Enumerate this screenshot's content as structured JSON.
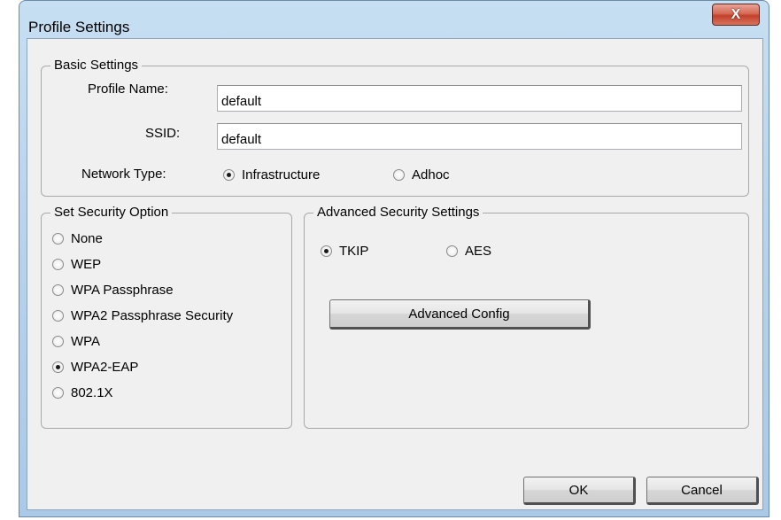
{
  "window": {
    "title": "Profile Settings",
    "close_glyph": "X"
  },
  "basic": {
    "legend": "Basic Settings",
    "profile_name_label": "Profile Name:",
    "profile_name_value": "default",
    "ssid_label": "SSID:",
    "ssid_value": "default",
    "network_type_label": "Network Type:",
    "network_options": [
      {
        "label": "Infrastructure",
        "selected": true
      },
      {
        "label": "Adhoc",
        "selected": false
      }
    ]
  },
  "security": {
    "legend": "Set Security Option",
    "options": [
      {
        "label": "None",
        "selected": false
      },
      {
        "label": "WEP",
        "selected": false
      },
      {
        "label": "WPA Passphrase",
        "selected": false
      },
      {
        "label": "WPA2 Passphrase Security",
        "selected": false
      },
      {
        "label": "WPA",
        "selected": false
      },
      {
        "label": "WPA2-EAP",
        "selected": true
      },
      {
        "label": "802.1X",
        "selected": false
      }
    ]
  },
  "advanced": {
    "legend": "Advanced Security Settings",
    "cipher_options": [
      {
        "label": "TKIP",
        "selected": true
      },
      {
        "label": "AES",
        "selected": false
      }
    ],
    "config_button": "Advanced Config"
  },
  "footer": {
    "ok_label": "OK",
    "cancel_label": "Cancel"
  }
}
